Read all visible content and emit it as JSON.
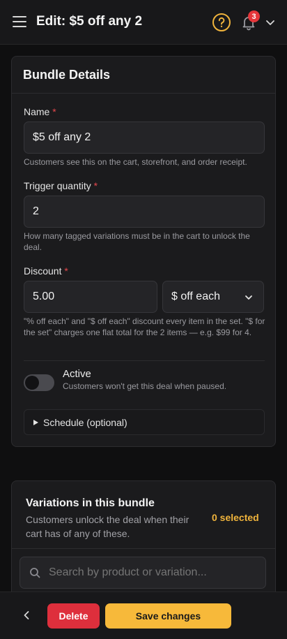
{
  "header": {
    "title": "Edit: $5 off any 2",
    "notification_count": "3"
  },
  "bundle_details": {
    "title": "Bundle Details",
    "name": {
      "label": "Name",
      "required_mark": "*",
      "value": "$5 off any 2",
      "help": "Customers see this on the cart, storefront, and order receipt."
    },
    "trigger_quantity": {
      "label": "Trigger quantity",
      "required_mark": "*",
      "value": "2",
      "help": "How many tagged variations must be in the cart to unlock the deal."
    },
    "discount": {
      "label": "Discount",
      "required_mark": "*",
      "value": "5.00",
      "type_selected": "$ off each",
      "help": "\"% off each\" and \"$ off each\" discount every item in the set. \"$ for the set\" charges one flat total for the 2 items — e.g. $99 for 4."
    },
    "active": {
      "label": "Active",
      "help": "Customers won't get this deal when paused.",
      "enabled": false
    },
    "schedule": {
      "label": "Schedule (optional)"
    }
  },
  "variations": {
    "title": "Variations in this bundle",
    "subtitle": "Customers unlock the deal when their cart has of any of these.",
    "selected_count": "0 selected",
    "search_placeholder": "Search by product or variation..."
  },
  "bottom_bar": {
    "delete_label": "Delete",
    "save_label": "Save changes"
  },
  "colors": {
    "accent": "#f7b93a",
    "danger": "#de2f3c",
    "required": "#e5484d",
    "background": "#0f0f10",
    "card": "#1b1b1d"
  }
}
